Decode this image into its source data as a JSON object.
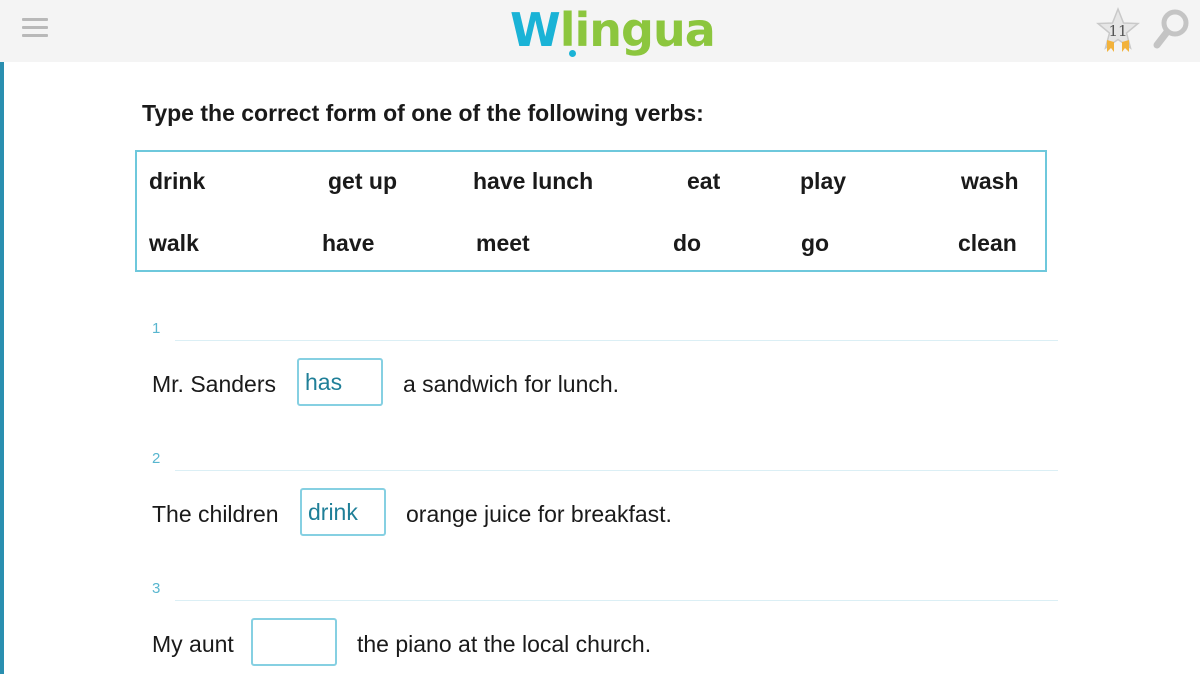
{
  "header": {
    "logo_w": "W",
    "logo_rest": "lingua",
    "star_count": "11"
  },
  "instruction": "Type the correct form of one of the following verbs:",
  "verbs": [
    [
      "drink",
      "get up",
      "have lunch",
      "eat",
      "play",
      "wash"
    ],
    [
      "walk",
      "have",
      "meet",
      "do",
      "go",
      "clean"
    ]
  ],
  "questions": [
    {
      "number": "1",
      "before": "Mr. Sanders",
      "answer": "has",
      "after": "a sandwich for lunch."
    },
    {
      "number": "2",
      "before": "The children",
      "answer": "drink",
      "after": "orange juice for breakfast."
    },
    {
      "number": "3",
      "before": "My aunt",
      "answer": "",
      "after": "the piano at the local church."
    }
  ],
  "colors": {
    "accent_blue": "#1ab3d6",
    "accent_green": "#8cc63e",
    "box_border": "#6ec8dc",
    "answer_text": "#1f7f98",
    "question_number": "#58b6cf"
  },
  "icons": {
    "menu": "hamburger-menu-icon",
    "star": "star-icon",
    "search": "search-icon"
  }
}
